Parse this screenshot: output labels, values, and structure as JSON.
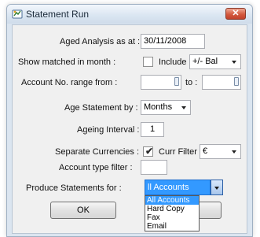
{
  "window": {
    "title": "Statement Run",
    "close_glyph": "✕"
  },
  "form": {
    "aged_analysis_label": "Aged Analysis as at :",
    "aged_analysis_value": "30/11/2008",
    "show_matched_label": "Show matched in month :",
    "show_matched_checked": false,
    "include_label": "Include :",
    "include_value": "+/- Bal",
    "account_range_label": "Account No. range from :",
    "account_range_from_value": "",
    "to_label": "to :",
    "account_range_to_value": "",
    "age_statement_label": "Age Statement by :",
    "age_statement_value": "Months",
    "ageing_interval_label": "Ageing Interval :",
    "ageing_interval_value": "1",
    "separate_currencies_label": "Separate Currencies :",
    "separate_currencies_checked": true,
    "curr_filter_label": "Curr Filter :",
    "curr_filter_value": "€",
    "account_type_filter_label": "Account type filter :",
    "account_type_filter_value": "",
    "produce_statements_label": "Produce Statements for :",
    "produce_statements_value": "ll Accounts"
  },
  "dropdown": {
    "options": [
      "All Accounts",
      "Hard Copy",
      "Fax",
      "Email"
    ],
    "highlighted_index": 0
  },
  "buttons": {
    "ok_label": "OK"
  },
  "icons": {
    "app": "statement-run-icon",
    "close": "close-icon",
    "checkmark": "checkmark-icon",
    "dropdown_arrow": "chevron-down-icon"
  },
  "colors": {
    "selection": "#3399ff",
    "close_button": "#d45a3f",
    "titlebar": "#dbe6f2"
  }
}
